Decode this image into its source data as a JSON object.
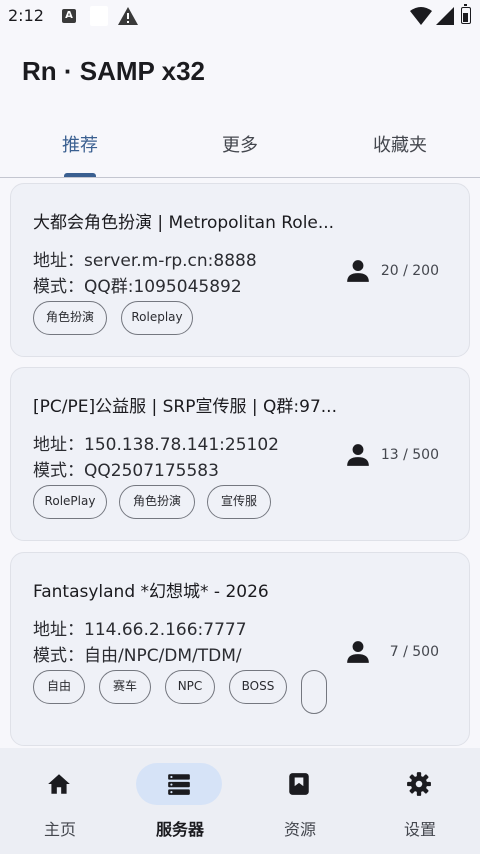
{
  "status_bar": {
    "time": "2:12",
    "icon_a": "A",
    "icons": [
      "a-icon",
      "white-square-icon",
      "warning-icon",
      "wifi-icon",
      "signal-icon",
      "battery-icon"
    ]
  },
  "app": {
    "title": "Rn · SAMP x32"
  },
  "tabs": [
    {
      "label": "推荐",
      "active": true
    },
    {
      "label": "更多",
      "active": false
    },
    {
      "label": "收藏夹",
      "active": false
    }
  ],
  "servers": [
    {
      "name": "大都会角色扮演 | Metropolitan Role...",
      "address": "地址：server.m-rp.cn:8888",
      "mode": "模式：QQ群:1095045892",
      "players": "20 / 200",
      "tags": [
        "角色扮演",
        "Roleplay"
      ]
    },
    {
      "name": "[PC/PE]公益服 | SRP宣传服 | Q群:97...",
      "address": "地址：150.138.78.141:25102",
      "mode": "模式：QQ2507175583",
      "players": "13 / 500",
      "tags": [
        "RolePlay",
        "角色扮演",
        "宣传服"
      ]
    },
    {
      "name": "Fantasyland *幻想城* - 2026",
      "address": "地址：114.66.2.166:7777",
      "mode": "模式：自由/NPC/DM/TDM/",
      "players": "7 / 500",
      "tags": [
        "自由",
        "赛车",
        "NPC",
        "BOSS",
        ""
      ]
    }
  ],
  "bottom_nav": [
    {
      "label": "主页",
      "icon": "home-icon",
      "active": false
    },
    {
      "label": "服务器",
      "icon": "server-list-icon",
      "active": true
    },
    {
      "label": "资源",
      "icon": "bookmark-icon",
      "active": false
    },
    {
      "label": "设置",
      "icon": "gear-icon",
      "active": false
    }
  ],
  "colors": {
    "accent": "#3a5f90",
    "nav_active_pill": "#d6e3f7",
    "card_bg": "#eff1f7"
  }
}
